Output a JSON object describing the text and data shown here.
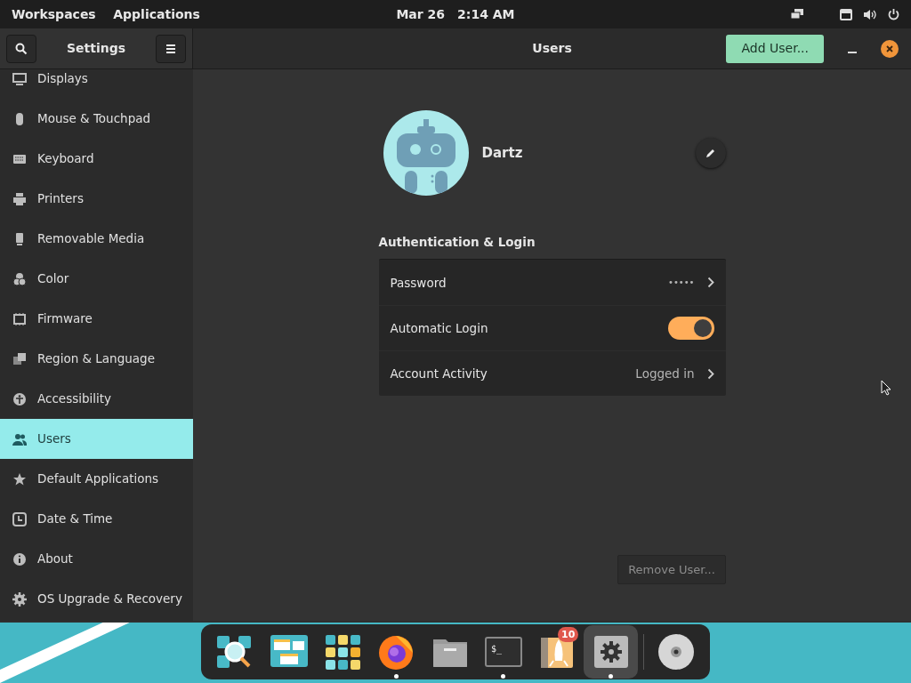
{
  "top_bar": {
    "workspaces": "Workspaces",
    "applications": "Applications",
    "date": "Mar 26",
    "time": "2:14 AM"
  },
  "sidebar": {
    "title": "Settings",
    "items": [
      {
        "label": "Displays",
        "selected": false
      },
      {
        "label": "Mouse & Touchpad",
        "selected": false
      },
      {
        "label": "Keyboard",
        "selected": false
      },
      {
        "label": "Printers",
        "selected": false
      },
      {
        "label": "Removable Media",
        "selected": false
      },
      {
        "label": "Color",
        "selected": false
      },
      {
        "label": "Firmware",
        "selected": false
      },
      {
        "label": "Region & Language",
        "selected": false
      },
      {
        "label": "Accessibility",
        "selected": false
      },
      {
        "label": "Users",
        "selected": true
      },
      {
        "label": "Default Applications",
        "selected": false
      },
      {
        "label": "Date & Time",
        "selected": false
      },
      {
        "label": "About",
        "selected": false
      },
      {
        "label": "OS Upgrade & Recovery",
        "selected": false
      }
    ]
  },
  "header": {
    "title": "Users",
    "add_button": "Add User..."
  },
  "user": {
    "name": "Dartz"
  },
  "section_title": "Authentication & Login",
  "rows": [
    {
      "kind": "link",
      "label": "Password",
      "value": "•••••"
    },
    {
      "kind": "toggle",
      "label": "Automatic Login",
      "on": true
    },
    {
      "kind": "link",
      "label": "Account Activity",
      "value": "Logged in"
    }
  ],
  "remove_button": "Remove User...",
  "dock": {
    "items": [
      {
        "running": false,
        "active": false
      },
      {
        "running": false,
        "active": false
      },
      {
        "running": false,
        "active": false
      },
      {
        "running": true,
        "active": false
      },
      {
        "running": false,
        "active": false
      },
      {
        "running": true,
        "active": false,
        "screen_text": "$_"
      },
      {
        "running": false,
        "active": false,
        "badge": "10"
      },
      {
        "running": true,
        "active": true
      },
      {
        "running": false,
        "active": false
      }
    ]
  }
}
